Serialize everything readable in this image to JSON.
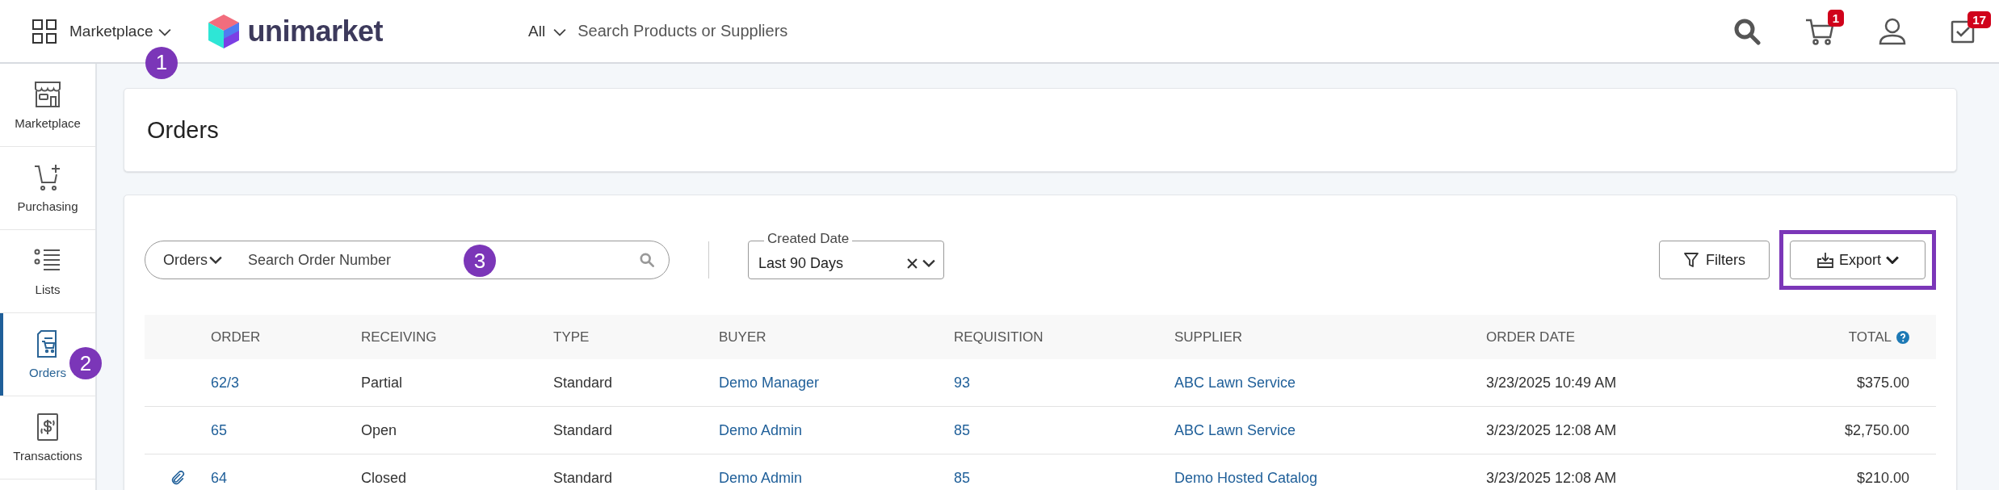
{
  "topbar": {
    "app_switcher": {
      "label": "Marketplace",
      "annotation": "1"
    },
    "logo_text": "unimarket",
    "search_scope": "All",
    "search_placeholder": "Search Products or Suppliers",
    "cart_count": "1",
    "tasks_count": "17"
  },
  "sidebar": {
    "items": [
      {
        "label": "Marketplace",
        "selected": false
      },
      {
        "label": "Purchasing",
        "selected": false
      },
      {
        "label": "Lists",
        "selected": false
      },
      {
        "label": "Orders",
        "selected": true,
        "annotation": "2"
      },
      {
        "label": "Transactions",
        "selected": false
      }
    ]
  },
  "page": {
    "title": "Orders"
  },
  "toolbar": {
    "search": {
      "scope": "Orders",
      "placeholder": "Search Order Number",
      "annotation": "3"
    },
    "date_filter": {
      "label": "Created Date",
      "value": "Last 90 Days"
    },
    "filters_button": "Filters",
    "export_button": {
      "label": "Export",
      "highlighted": true
    }
  },
  "table": {
    "columns": [
      {
        "label": "ORDER"
      },
      {
        "label": "RECEIVING"
      },
      {
        "label": "TYPE"
      },
      {
        "label": "BUYER"
      },
      {
        "label": "REQUISITION"
      },
      {
        "label": "SUPPLIER"
      },
      {
        "label": "ORDER DATE"
      },
      {
        "label": "TOTAL",
        "help": true
      }
    ],
    "rows": [
      {
        "attachment": false,
        "order": "62/3",
        "receiving": "Partial",
        "type": "Standard",
        "buyer": "Demo Manager",
        "requisition": "93",
        "supplier": "ABC Lawn Service",
        "order_date": "3/23/2025 10:49 AM",
        "total": "$375.00"
      },
      {
        "attachment": false,
        "order": "65",
        "receiving": "Open",
        "type": "Standard",
        "buyer": "Demo Admin",
        "requisition": "85",
        "supplier": "ABC Lawn Service",
        "order_date": "3/23/2025 12:08 AM",
        "total": "$2,750.00"
      },
      {
        "attachment": true,
        "order": "64",
        "receiving": "Closed",
        "type": "Standard",
        "buyer": "Demo Admin",
        "requisition": "85",
        "supplier": "Demo Hosted Catalog",
        "order_date": "3/23/2025 12:08 AM",
        "total": "$210.00"
      }
    ]
  }
}
